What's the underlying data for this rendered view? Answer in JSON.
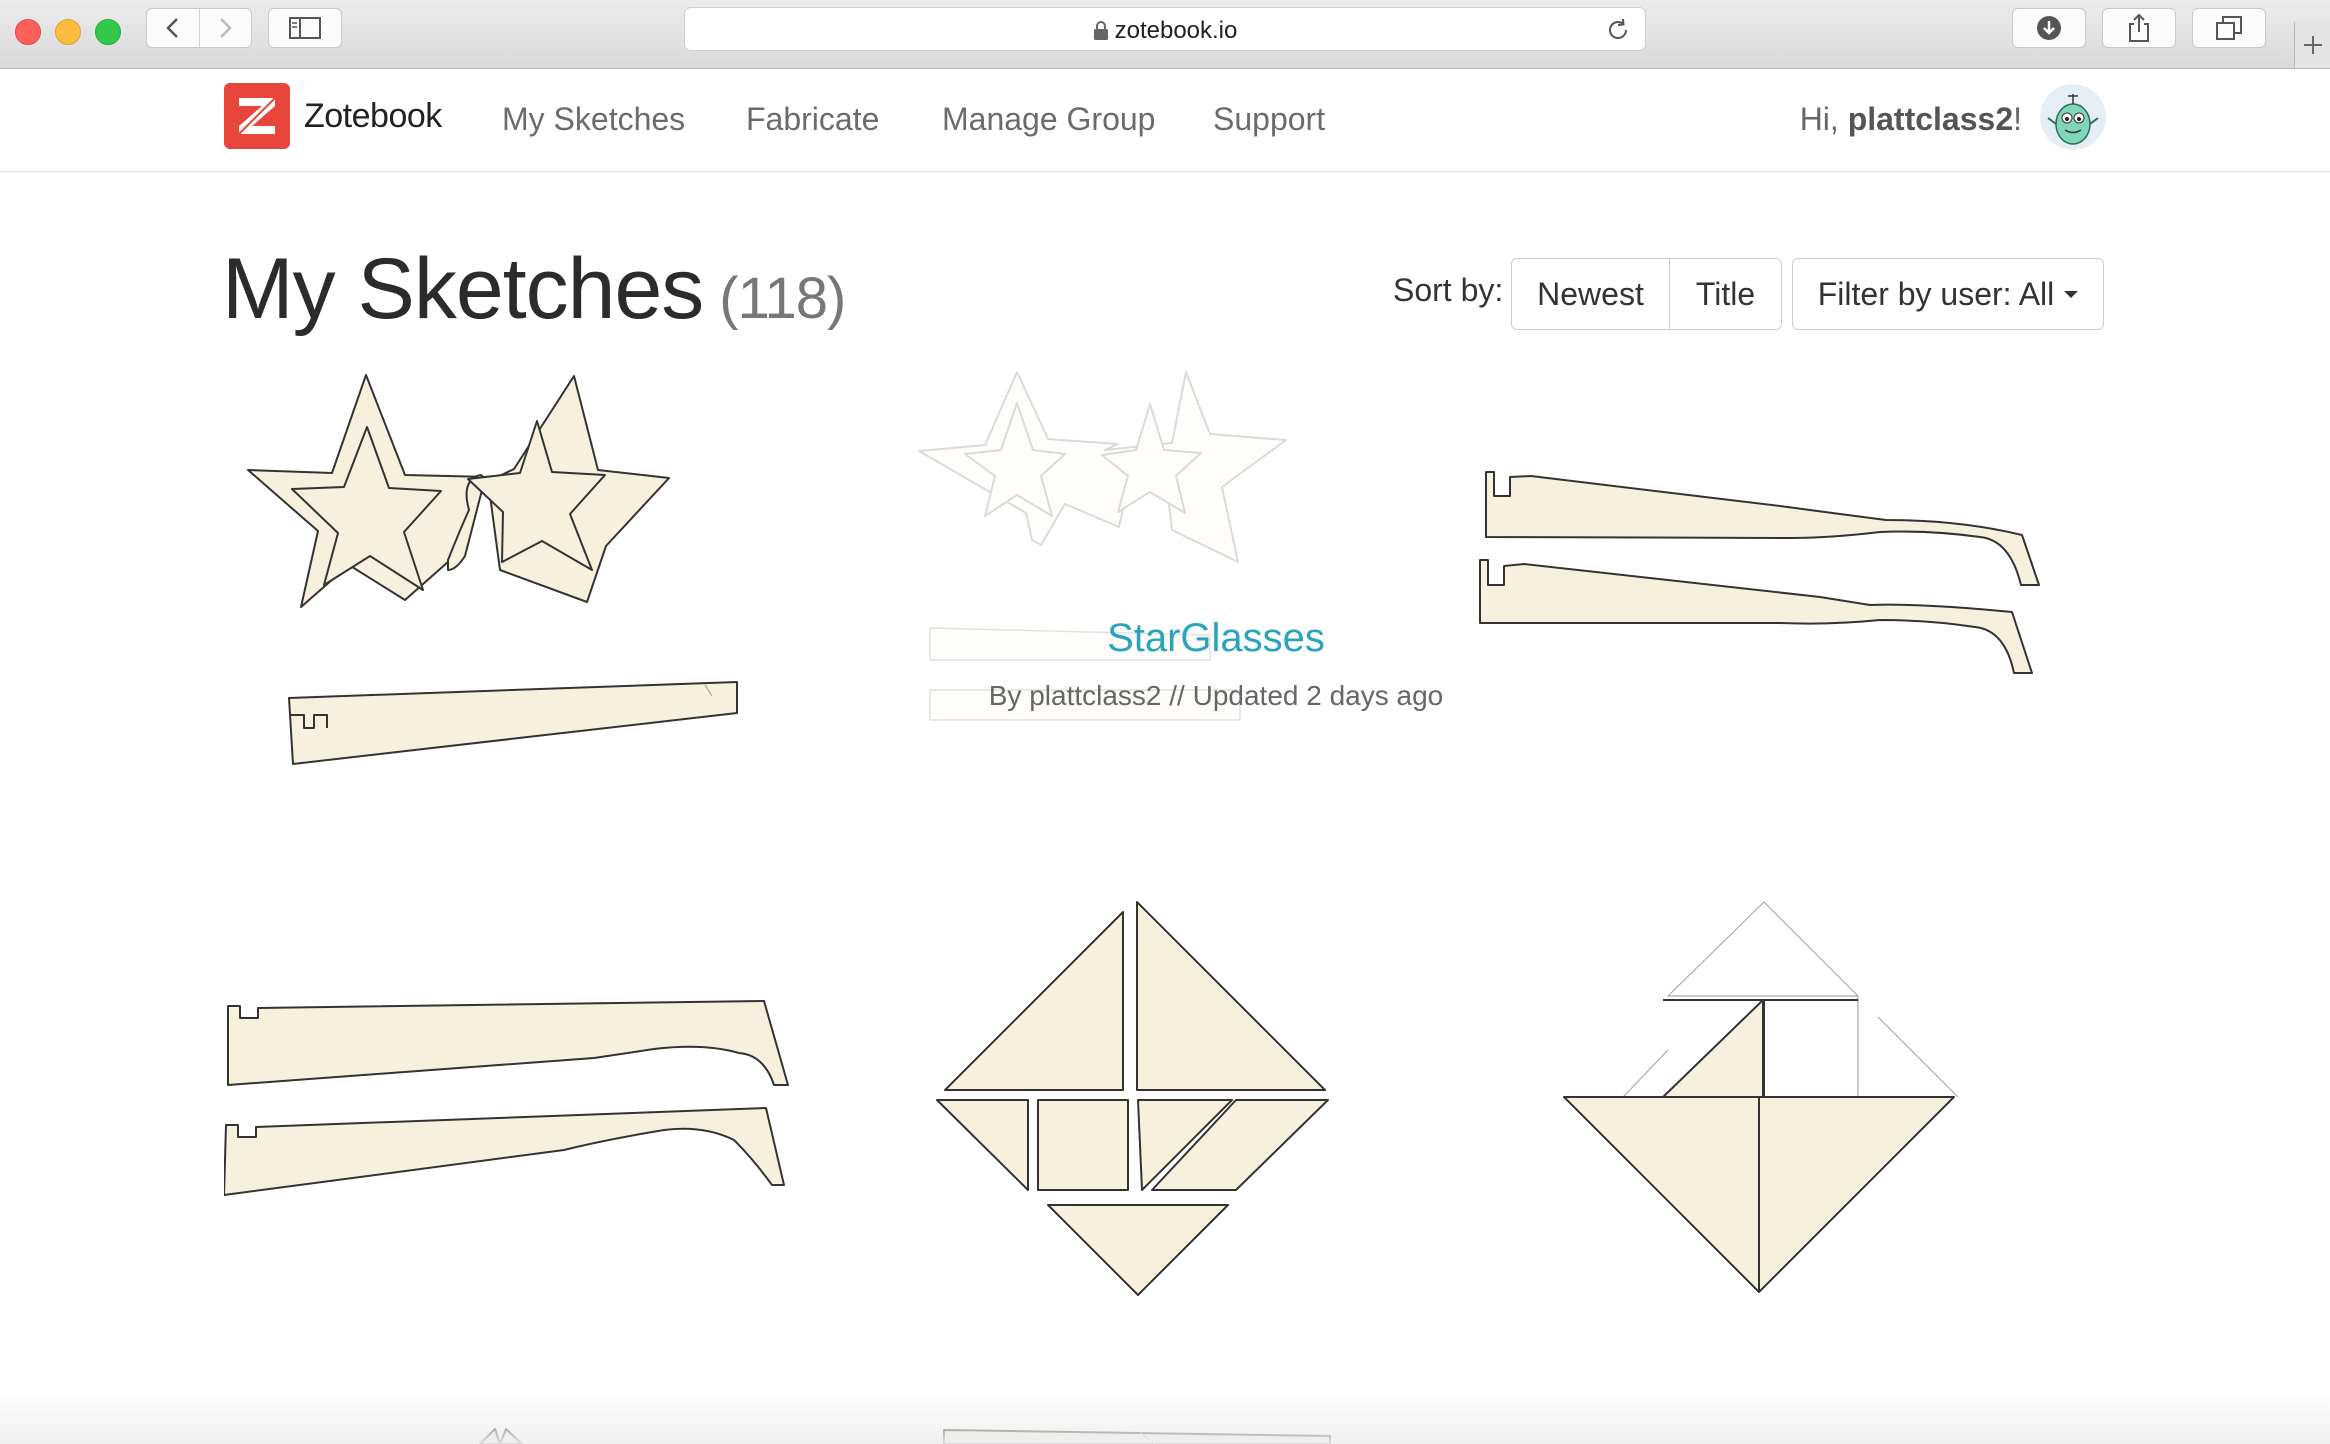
{
  "browser": {
    "url": "zotebook.io",
    "icons": {
      "back": "back-arrow-icon",
      "forward": "forward-arrow-icon",
      "sidebar": "sidebar-icon",
      "lock": "lock-icon",
      "reload": "reload-icon",
      "download": "download-icon",
      "share": "share-icon",
      "tabs": "tabs-icon",
      "new_tab": "plus-icon"
    }
  },
  "header": {
    "brand": "Zotebook",
    "nav": [
      "My Sketches",
      "Fabricate",
      "Manage Group",
      "Support"
    ],
    "greeting_prefix": "Hi, ",
    "username": "plattclass2",
    "greeting_suffix": "!",
    "brand_color": "#e8453c"
  },
  "page": {
    "title": "My Sketches",
    "count": "(118)",
    "sort_label": "Sort by:",
    "sort_options": [
      "Newest",
      "Title"
    ],
    "filter_label": "Filter by user: All"
  },
  "sketches": [
    {
      "title": "StarGlasses",
      "meta": "By plattclass2 // Updated 2 days ago"
    }
  ],
  "colors": {
    "link": "#2aa3bd",
    "sketch_fill": "#f7f0dd"
  }
}
